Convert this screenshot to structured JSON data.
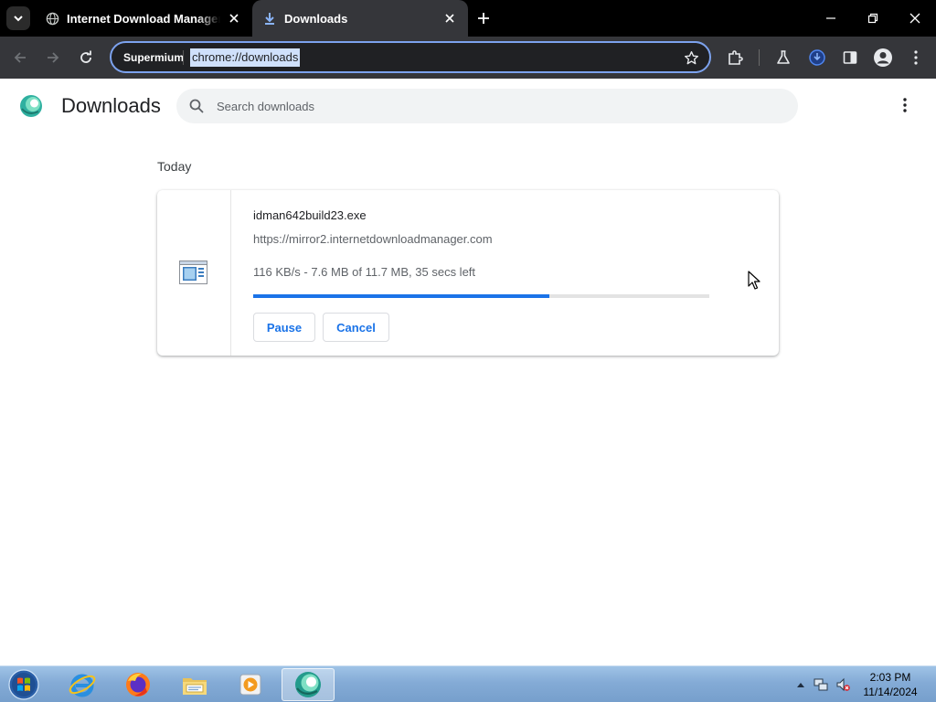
{
  "browser": {
    "tabs": [
      {
        "title": "Internet Download Manager is",
        "icon": "globe-icon",
        "active": false
      },
      {
        "title": "Downloads",
        "icon": "download-icon",
        "active": true
      }
    ],
    "toolbar": {
      "profile_chip": "Supermium",
      "url": "chrome://downloads"
    }
  },
  "downloads": {
    "title": "Downloads",
    "search_placeholder": "Search downloads",
    "section_label": "Today",
    "items": [
      {
        "file_name": "idman642build23.exe",
        "source_url": "https://mirror2.internetdownloadmanager.com",
        "status": "116 KB/s - 7.6 MB of 11.7 MB, 35 secs left",
        "progress_fraction": 0.65,
        "pause_label": "Pause",
        "cancel_label": "Cancel"
      }
    ]
  },
  "taskbar": {
    "apps": [
      "internet-explorer-icon",
      "firefox-icon",
      "file-explorer-icon",
      "media-player-icon",
      "browser-icon"
    ],
    "clock_time": "2:03 PM",
    "clock_date": "11/14/2024"
  },
  "colors": {
    "accent": "#1a73e8",
    "omnibox_border": "#7ca2ee",
    "tab_active": "#35363a"
  }
}
